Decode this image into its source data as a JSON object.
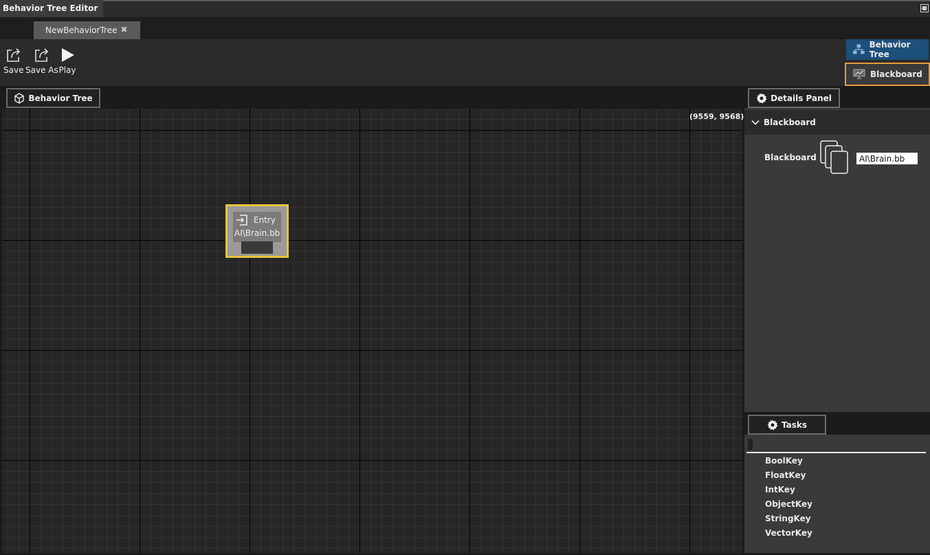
{
  "window": {
    "title": "Behavior Tree Editor"
  },
  "tabs": [
    {
      "label": "NewBehaviorTree"
    }
  ],
  "toolbar": {
    "save_label": "Save",
    "save_as_label": "Save As",
    "play_label": "Play"
  },
  "modes": {
    "behavior_tree": "Behavior Tree",
    "blackboard": "Blackboard",
    "active": "Blackboard"
  },
  "canvas": {
    "header_label": "Behavior Tree",
    "coordinates": "(9559, 9568)"
  },
  "entry_node": {
    "title": "Entry",
    "blackboard": "AI\\Brain.bb"
  },
  "details": {
    "header_label": "Details Panel",
    "section_title": "Blackboard",
    "property_label": "Blackboard",
    "property_value": "AI\\Brain.bb"
  },
  "tasks": {
    "header_label": "Tasks",
    "search_value": "",
    "items": [
      "BoolKey",
      "FloatKey",
      "IntKey",
      "ObjectKey",
      "StringKey",
      "VectorKey"
    ]
  },
  "colors": {
    "accent_blue": "#1c4f7a",
    "highlight_orange": "#e59a3c",
    "node_selected": "#e8c53a"
  },
  "icons": [
    "pin-icon",
    "close-icon",
    "save-icon",
    "save-as-icon",
    "play-icon",
    "tree-icon",
    "blackboard-icon",
    "cube-icon",
    "gear-icon",
    "chevron-down-icon",
    "entry-icon",
    "blackboard-asset-icon"
  ]
}
